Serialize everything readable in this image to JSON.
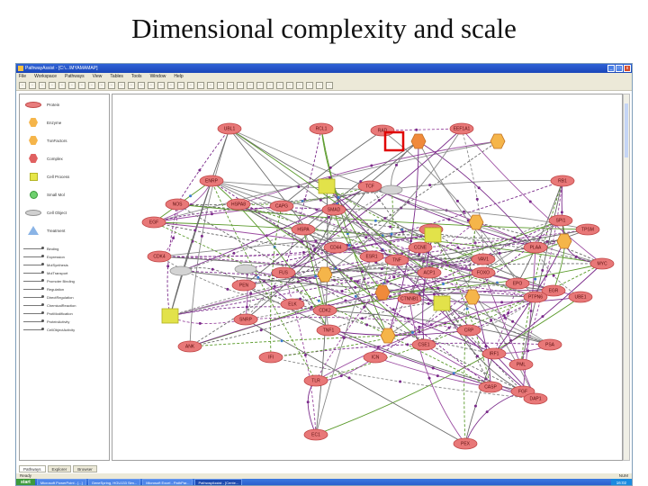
{
  "slide": {
    "title": "Dimensional complexity and scale"
  },
  "window": {
    "title": "PathwayAssist - [C:\\...\\MYAMAMAP]",
    "menus": [
      "File",
      "Workspace",
      "Pathways",
      "View",
      "Tables",
      "Tools",
      "Window",
      "Help"
    ]
  },
  "toolbar_icons": [
    "new-icon",
    "open-icon",
    "save-icon",
    "print-icon",
    "cut-icon",
    "copy-icon",
    "paste-icon",
    "undo-icon",
    "redo-icon",
    "zoom-in-icon",
    "zoom-out-icon",
    "find-icon",
    "layout-icon",
    "filter-icon",
    "settings-icon",
    "help-icon",
    "back-icon",
    "forward-icon",
    "home-icon",
    "refresh-icon",
    "stop-icon",
    "grid-icon",
    "select-icon",
    "pan-icon",
    "export-icon",
    "import-icon",
    "info-icon",
    "link-icon",
    "table-icon",
    "graph-icon",
    "options-icon",
    "window-icon"
  ],
  "legend": {
    "shapes": [
      {
        "label": "Protein",
        "shape": "ellipse"
      },
      {
        "label": "Enzyme",
        "shape": "hex"
      },
      {
        "label": "TxnFactors",
        "shape": "hex"
      },
      {
        "label": "Complex",
        "shape": "hex-red"
      },
      {
        "label": "Cell Process",
        "shape": "square"
      },
      {
        "label": "Small Mol",
        "shape": "circle"
      },
      {
        "label": "Cell Object",
        "shape": "ellipse-grey"
      },
      {
        "label": "Treatment",
        "shape": "triangle"
      }
    ],
    "relations": [
      "Binding",
      "Expression",
      "MolSynthesis",
      "MolTransport",
      "Promoter Binding",
      "Regulation",
      "DirectRegulation",
      "ChemicalReaction",
      "ProtModification",
      "ProteinActivity",
      "CellObjectActivity"
    ]
  },
  "tabs": [
    "Pathways",
    "Explorer",
    "Browser"
  ],
  "status": {
    "left": "Ready",
    "right": "NUM"
  },
  "taskbar": {
    "start": "start",
    "tasks": [
      "Microsoft PowerPoint - [...]",
      "GeneSpring, HGU133 Sim...",
      "Microsoft Excel - PathPar...",
      "PathwayAssist - [Cente..."
    ],
    "clock": "16:02"
  },
  "network": {
    "nodes": [
      {
        "label": "UBL1",
        "type": "protein"
      },
      {
        "label": "RCL1",
        "type": "protein"
      },
      {
        "label": "RAD",
        "type": "protein"
      },
      {
        "label": "EEF1A1",
        "type": "protein"
      },
      {
        "label": "",
        "type": "enzyme"
      },
      {
        "label": "",
        "type": "complex"
      },
      {
        "label": "ENRP",
        "type": "protein"
      },
      {
        "label": "",
        "type": "process"
      },
      {
        "label": "TCF",
        "type": "protein"
      },
      {
        "label": "RB1",
        "type": "protein"
      },
      {
        "label": "NOS",
        "type": "protein"
      },
      {
        "label": "HSPA8",
        "type": "protein"
      },
      {
        "label": "CAPG",
        "type": "protein"
      },
      {
        "label": "SMAD",
        "type": "protein"
      },
      {
        "label": "",
        "type": "object"
      },
      {
        "label": "EGF",
        "type": "protein"
      },
      {
        "label": "HSPA",
        "type": "protein"
      },
      {
        "label": "ESR1",
        "type": "protein"
      },
      {
        "label": "RPS2",
        "type": "protein"
      },
      {
        "label": "",
        "type": "enzyme"
      },
      {
        "label": "SPI1",
        "type": "protein"
      },
      {
        "label": "TPSM",
        "type": "protein"
      },
      {
        "label": "",
        "type": "process"
      },
      {
        "label": "",
        "type": "enzyme"
      },
      {
        "label": "CD44",
        "type": "protein"
      },
      {
        "label": "TNF",
        "type": "protein"
      },
      {
        "label": "CCNE",
        "type": "protein"
      },
      {
        "label": "VAV1",
        "type": "protein"
      },
      {
        "label": "PLAA",
        "type": "protein"
      },
      {
        "label": "MYC",
        "type": "protein"
      },
      {
        "label": "CDK4",
        "type": "protein"
      },
      {
        "label": "",
        "type": "object"
      },
      {
        "label": "FUS",
        "type": "protein"
      },
      {
        "label": "",
        "type": "enzyme"
      },
      {
        "label": "ACP1",
        "type": "protein"
      },
      {
        "label": "FOXO",
        "type": "protein"
      },
      {
        "label": "EPO",
        "type": "protein"
      },
      {
        "label": "EGR",
        "type": "protein"
      },
      {
        "label": "",
        "type": "object"
      },
      {
        "label": "PEN",
        "type": "protein"
      },
      {
        "label": "ELK",
        "type": "protein"
      },
      {
        "label": "CDK2",
        "type": "protein"
      },
      {
        "label": "",
        "type": "complex"
      },
      {
        "label": "CTNNB1",
        "type": "protein"
      },
      {
        "label": "",
        "type": "process"
      },
      {
        "label": "",
        "type": "enzyme"
      },
      {
        "label": "PTPN6",
        "type": "protein"
      },
      {
        "label": "UBE1",
        "type": "protein"
      },
      {
        "label": "",
        "type": "process"
      },
      {
        "label": "SNRP",
        "type": "protein"
      },
      {
        "label": "TNF1",
        "type": "protein"
      },
      {
        "label": "",
        "type": "enzyme"
      },
      {
        "label": "CSE1",
        "type": "protein"
      },
      {
        "label": "ICN",
        "type": "protein"
      },
      {
        "label": "CRP",
        "type": "protein"
      },
      {
        "label": "IRF1",
        "type": "protein"
      },
      {
        "label": "PML",
        "type": "protein"
      },
      {
        "label": "PSA",
        "type": "protein"
      },
      {
        "label": "ANK",
        "type": "protein"
      },
      {
        "label": "IFI",
        "type": "protein"
      },
      {
        "label": "TLR",
        "type": "protein"
      },
      {
        "label": "CASP",
        "type": "protein"
      },
      {
        "label": "FGF",
        "type": "protein"
      },
      {
        "label": "DAP1",
        "type": "protein"
      },
      {
        "label": "EC1",
        "type": "protein"
      },
      {
        "label": "PEX",
        "type": "protein"
      }
    ]
  }
}
